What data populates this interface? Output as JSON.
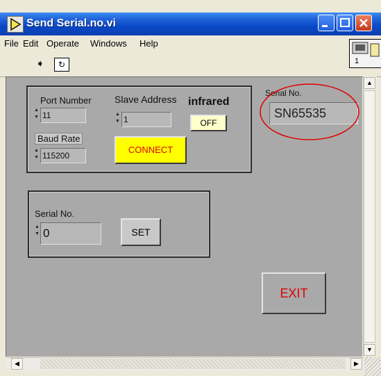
{
  "window": {
    "title": "Send Serial.no.vi"
  },
  "menu": [
    "File",
    "Edit",
    "Operate",
    "Windows",
    "Help"
  ],
  "vi_icon": {
    "number": "1"
  },
  "comm_group": {
    "port_label": "Port Number",
    "port_value": "11",
    "baud_label": "Baud Rate",
    "baud_value": "115200",
    "slave_label": "Slave Address",
    "slave_value": "1",
    "infrared_label": "infrared",
    "infrared_value": "OFF",
    "connect_label": "CONNECT"
  },
  "serial_indicator": {
    "label": "Serial No.",
    "value": "SN65535"
  },
  "set_group": {
    "label": "Serial No.",
    "value": "0",
    "set_label": "SET"
  },
  "exit_label": "EXIT",
  "colors": {
    "connect_bg": "#ffff00",
    "connect_text": "#e00000",
    "exit_text": "#e00000",
    "annotation": "#e00000"
  }
}
